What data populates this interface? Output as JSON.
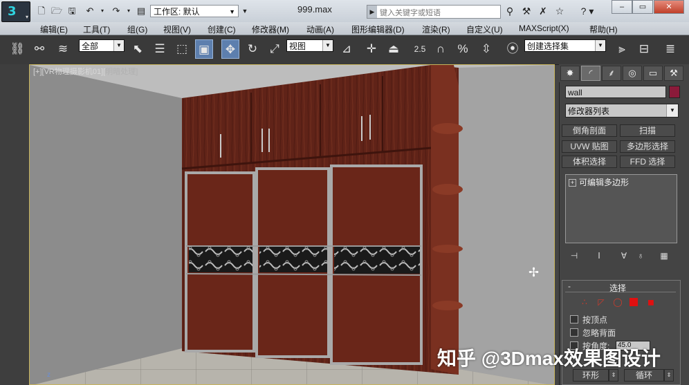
{
  "titlebar": {
    "workspace_label": "工作区: 默认",
    "file_title": "999.max",
    "search_placeholder": "键入关键字或短语",
    "help_label": "?",
    "win_min": "–",
    "win_max": "▭",
    "win_close": "✕"
  },
  "menu": [
    "编辑(E)",
    "工具(T)",
    "组(G)",
    "视图(V)",
    "创建(C)",
    "修改器(M)",
    "动画(A)",
    "图形编辑器(D)",
    "渲染(R)",
    "自定义(U)",
    "MAXScript(X)",
    "帮助(H)"
  ],
  "toolbar": {
    "selection_filter": "全部",
    "ref_coord": "视图",
    "snap_value": "2.5",
    "named_selection": "创建选择集"
  },
  "viewport": {
    "label_bracket": "[+][VR物理摄影机01][",
    "label_mode": "明暗处理]",
    "axis_label": "z"
  },
  "panel": {
    "object_name": "wall",
    "object_color": "#8b1a3a",
    "modifier_list": "修改器列表",
    "modifier_buttons": [
      "倒角剖面",
      "扫描",
      "UVW 贴图",
      "多边形选择",
      "体积选择",
      "FFD 选择"
    ],
    "stack_item": "可编辑多边形",
    "selection_rollout": {
      "title": "选择",
      "checkboxes": [
        "按顶点",
        "忽略背面",
        "按角度:"
      ],
      "angle_value": "45.0",
      "bottom_buttons": [
        "环形",
        "循环"
      ]
    }
  },
  "watermark": "知乎 @3Dmax效果图设计"
}
